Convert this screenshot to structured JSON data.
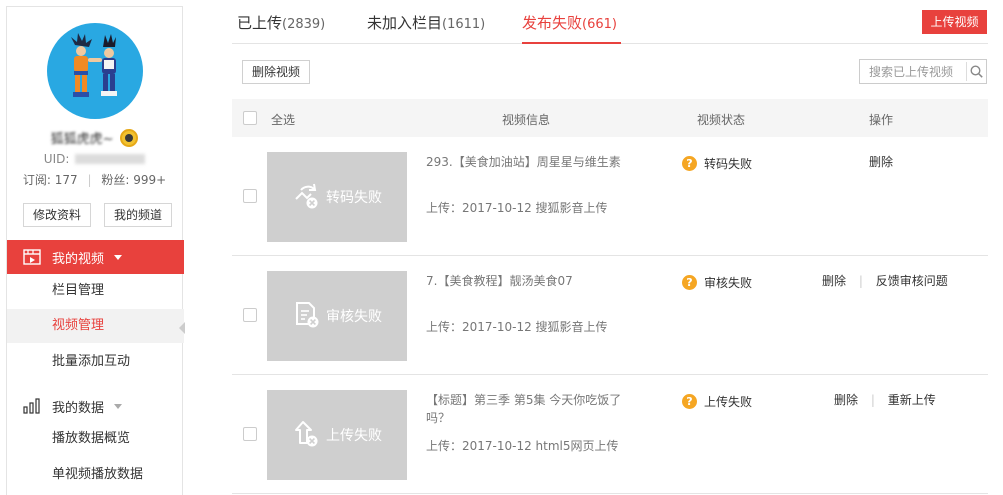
{
  "profile": {
    "username": "狐狐虎虎~",
    "uid_label": "UID:",
    "subscriptions_label": "订阅:",
    "subscriptions_value": "177",
    "fans_label": "粉丝:",
    "fans_value": "999+",
    "edit_button": "修改资料",
    "channel_button": "我的频道",
    "avatar_color": "#29a8e2"
  },
  "sidebar": {
    "my_videos": "我的视频",
    "sub_items": [
      "栏目管理",
      "视频管理",
      "批量添加互动"
    ],
    "selected_index": 1,
    "my_data": "我的数据",
    "data_items": [
      "播放数据概览",
      "单视频播放数据"
    ]
  },
  "tabs": [
    {
      "label": "已上传",
      "count": "(2839)"
    },
    {
      "label": "未加入栏目",
      "count": "(1611)"
    },
    {
      "label": "发布失败",
      "count": "(661)"
    }
  ],
  "active_tab_index": 2,
  "toolbar": {
    "upload_label": "上传视频",
    "delete_label": "删除视频",
    "search_placeholder": "搜索已上传视频"
  },
  "table": {
    "select_all": "全选",
    "columns": [
      "视频信息",
      "视频状态",
      "操作"
    ]
  },
  "rows": [
    {
      "thumb_text": "转码失败",
      "thumb_icon": "transcode-failed-icon",
      "title": "293.【美食加油站】周星星与维生素",
      "upload": "上传：2017-10-12 搜狐影音上传",
      "status": "转码失败",
      "actions": [
        "删除"
      ]
    },
    {
      "thumb_text": "审核失败",
      "thumb_icon": "review-failed-icon",
      "title": "7.【美食教程】靓汤美食07",
      "upload": "上传：2017-10-12 搜狐影音上传",
      "status": "审核失败",
      "actions": [
        "删除",
        "反馈审核问题"
      ]
    },
    {
      "thumb_text": "上传失败",
      "thumb_icon": "upload-failed-icon",
      "title": "【标题】第三季 第5集 今天你吃饭了吗？",
      "upload": "上传：2017-10-12 html5网页上传",
      "status": "上传失败",
      "actions": [
        "删除",
        "重新上传"
      ]
    }
  ],
  "colors": {
    "accent": "#e8413d",
    "warning": "#f5a623",
    "thumb_bg": "#cfcfcf"
  }
}
